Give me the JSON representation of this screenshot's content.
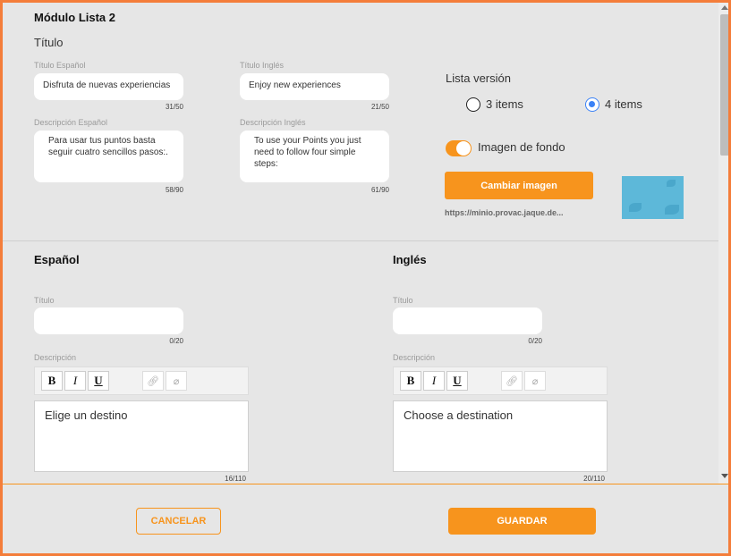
{
  "module": {
    "title": "Módulo Lista 2",
    "section_title": "Título",
    "titulo_es": {
      "label": "Título Español",
      "value": "Disfruta de nuevas experiencias",
      "counter": "31/50"
    },
    "titulo_en": {
      "label": "Título Inglés",
      "value": "Enjoy new experiences",
      "counter": "21/50"
    },
    "desc_es": {
      "label": "Descripción Español",
      "value": "Para usar tus puntos basta seguir cuatro sencillos pasos:.",
      "counter": "58/90"
    },
    "desc_en": {
      "label": "Descripción Inglés",
      "value": "To use your Points you just need to follow four simple steps:",
      "counter": "61/90"
    },
    "lista_version": {
      "label": "Lista versión",
      "option_3": "3 items",
      "option_4": "4 items",
      "selected": "4 items"
    },
    "background": {
      "label": "Imagen de fondo",
      "enabled": true
    },
    "change_image_button": "Cambiar imagen",
    "image_url": "https://minio.provac.jaque.de..."
  },
  "espanol": {
    "heading": "Español",
    "titulo_label": "Título",
    "titulo_value": "",
    "titulo_counter": "0/20",
    "desc_label": "Descripción",
    "desc_value": "Elige un destino",
    "desc_counter": "16/110"
  },
  "ingles": {
    "heading": "Inglés",
    "titulo_label": "Título",
    "titulo_value": "",
    "titulo_counter": "0/20",
    "desc_label": "Descripción",
    "desc_value": "Choose a destination",
    "desc_counter": "20/110"
  },
  "toolbar": {
    "bold": "B",
    "italic": "I",
    "underline": "U",
    "link_icon": "link-icon",
    "unlink_icon": "unlink-icon"
  },
  "footer": {
    "cancel": "CANCELAR",
    "save": "GUARDAR"
  },
  "colors": {
    "accent": "#f7941d",
    "frame": "#f47d3a",
    "radio_selected": "#3b82f6"
  }
}
